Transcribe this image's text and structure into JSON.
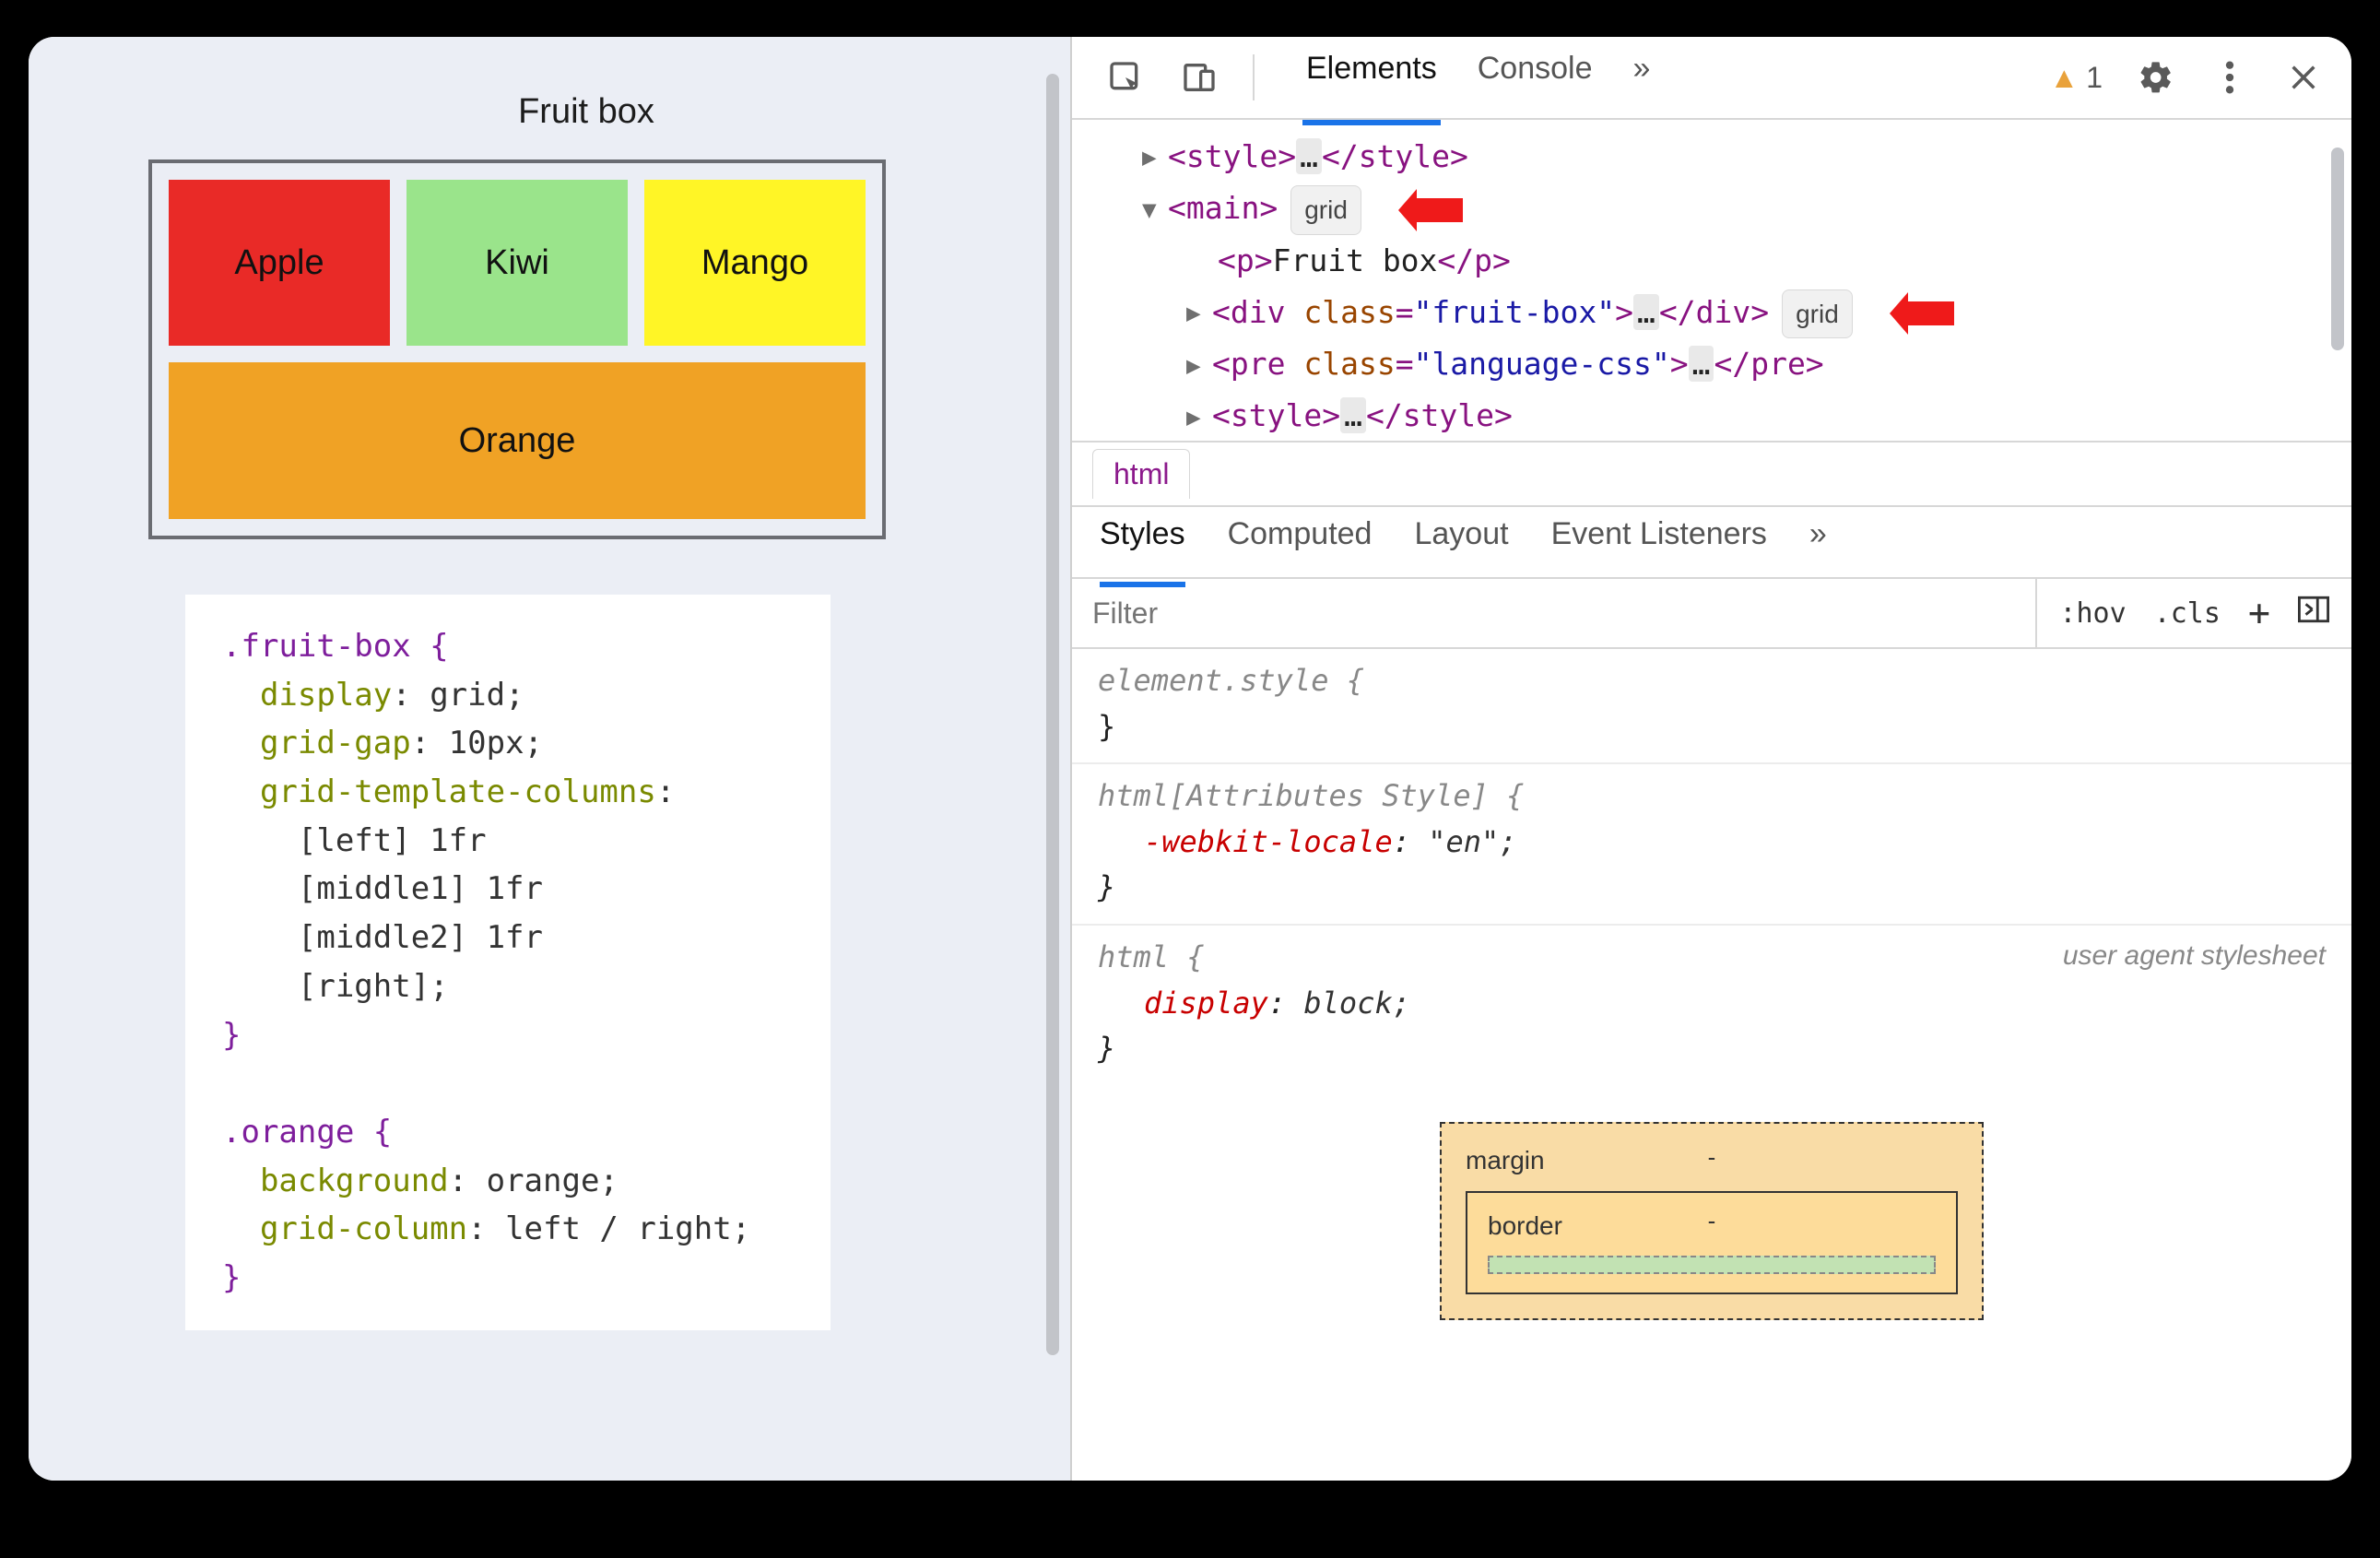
{
  "page": {
    "title": "Fruit box",
    "fruits": {
      "apple": "Apple",
      "kiwi": "Kiwi",
      "mango": "Mango",
      "orange": "Orange"
    },
    "css_code": ".fruit-box {\n  display: grid;\n  grid-gap: 10px;\n  grid-template-columns:\n    [left] 1fr\n    [middle1] 1fr\n    [middle2] 1fr\n    [right];\n}\n\n.orange {\n  background: orange;\n  grid-column: left / right;\n}",
    "css_lines": [
      {
        "t": "sel",
        "s": ".fruit-box {"
      },
      {
        "t": "decl",
        "p": "display",
        "v": "grid;"
      },
      {
        "t": "decl",
        "p": "grid-gap",
        "v": "10px;"
      },
      {
        "t": "decl-open",
        "p": "grid-template-columns",
        "v": ""
      },
      {
        "t": "cont",
        "v": "[left] 1fr"
      },
      {
        "t": "cont",
        "v": "[middle1] 1fr"
      },
      {
        "t": "cont",
        "v": "[middle2] 1fr"
      },
      {
        "t": "cont",
        "v": "[right];"
      },
      {
        "t": "close",
        "s": "}"
      },
      {
        "t": "blank",
        "s": ""
      },
      {
        "t": "sel",
        "s": ".orange {"
      },
      {
        "t": "decl",
        "p": "background",
        "v": "orange;"
      },
      {
        "t": "decl",
        "p": "grid-column",
        "v": "left / right;"
      },
      {
        "t": "close",
        "s": "}"
      }
    ]
  },
  "devtools": {
    "tabs": {
      "elements": "Elements",
      "console": "Console"
    },
    "more_tabs_glyph": "»",
    "warning_count": "1",
    "dom": {
      "line0": {
        "open": "<style>",
        "ell": "…",
        "close": "</style>"
      },
      "line1": {
        "open": "<main>",
        "badge": "grid"
      },
      "line2": {
        "open": "<p>",
        "text": "Fruit box",
        "close": "</p>"
      },
      "line3": {
        "open": "<div ",
        "attr_n": "class",
        "attr_v": "\"fruit-box\"",
        "open_end": ">",
        "ell": "…",
        "close": "</div>",
        "badge": "grid"
      },
      "line4": {
        "open": "<pre ",
        "attr_n": "class",
        "attr_v": "\"language-css\"",
        "open_end": ">",
        "ell": "…",
        "close": "</pre>"
      },
      "line5": {
        "open": "<style>",
        "ell": "…",
        "close": "</style>"
      }
    },
    "breadcrumb": "html",
    "styles_tabs": {
      "styles": "Styles",
      "computed": "Computed",
      "layout": "Layout",
      "event": "Event Listeners"
    },
    "filter_placeholder": "Filter",
    "filter_tools": {
      "hov": ":hov",
      "cls": ".cls",
      "plus": "+",
      "panel": "toggle"
    },
    "rules": {
      "r0": {
        "sel": "element.style {",
        "close": "}"
      },
      "r1": {
        "sel": "html[Attributes Style] {",
        "p": "-webkit-locale",
        "v": "\"en\";",
        "close": "}"
      },
      "r2": {
        "sel": "html {",
        "note": "user agent stylesheet",
        "p": "display",
        "v": "block;",
        "close": "}"
      }
    },
    "boxmodel": {
      "margin": "margin",
      "border": "border",
      "margin_dash": "-",
      "border_dash": "-"
    }
  }
}
